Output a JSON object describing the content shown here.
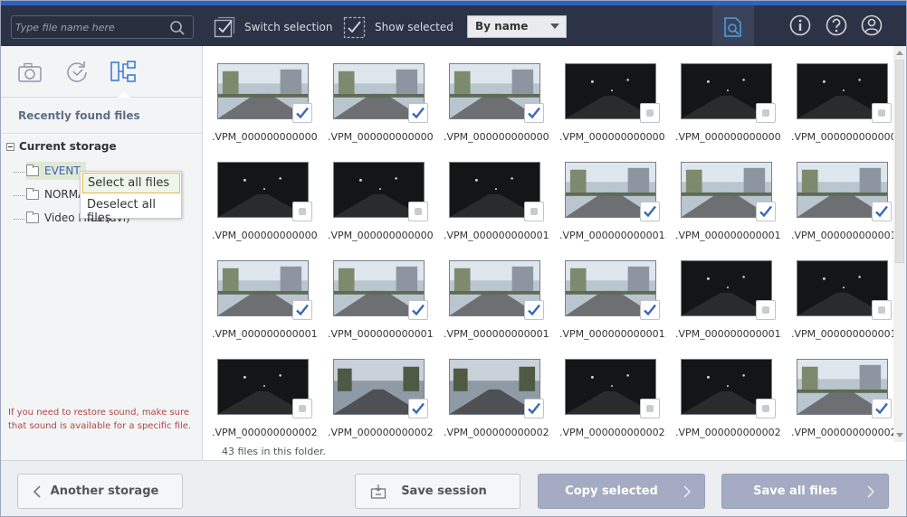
{
  "search": {
    "placeholder": "Type file name here"
  },
  "toolbar": {
    "switch_selection": "Switch selection",
    "show_selected": "Show selected",
    "sort_value": "By name"
  },
  "left": {
    "recent_label": "Recently found files",
    "storage_label": "Current storage",
    "folders": [
      "EVENT",
      "NORMAL",
      "Video Files (avi)"
    ],
    "hint": "If you need to restore sound, make sure that sound is available for a specific file."
  },
  "context_menu": {
    "select_all": "Select all files",
    "deselect_all": "Deselect all files"
  },
  "files": [
    {
      "name": ".VPM_000000000000...",
      "checked": true,
      "scene": "day"
    },
    {
      "name": ".VPM_000000000000...",
      "checked": true,
      "scene": "day"
    },
    {
      "name": ".VPM_000000000000...",
      "checked": true,
      "scene": "day"
    },
    {
      "name": ".VPM_000000000000...",
      "checked": false,
      "scene": "night"
    },
    {
      "name": ".VPM_000000000000...",
      "checked": false,
      "scene": "night"
    },
    {
      "name": ".VPM_000000000000...",
      "checked": false,
      "scene": "night"
    },
    {
      "name": ".VPM_000000000000...",
      "checked": false,
      "scene": "night"
    },
    {
      "name": ".VPM_000000000000...",
      "checked": false,
      "scene": "night"
    },
    {
      "name": ".VPM_000000000001...",
      "checked": false,
      "scene": "night"
    },
    {
      "name": ".VPM_000000000001...",
      "checked": true,
      "scene": "day"
    },
    {
      "name": ".VPM_000000000001...",
      "checked": true,
      "scene": "day"
    },
    {
      "name": ".VPM_000000000001...",
      "checked": true,
      "scene": "day"
    },
    {
      "name": ".VPM_000000000001...",
      "checked": true,
      "scene": "day"
    },
    {
      "name": ".VPM_000000000001...",
      "checked": true,
      "scene": "day"
    },
    {
      "name": ".VPM_000000000001...",
      "checked": true,
      "scene": "day"
    },
    {
      "name": ".VPM_000000000001...",
      "checked": true,
      "scene": "day"
    },
    {
      "name": ".VPM_000000000001...",
      "checked": false,
      "scene": "night"
    },
    {
      "name": ".VPM_000000000001...",
      "checked": false,
      "scene": "night"
    },
    {
      "name": ".VPM_000000000002...",
      "checked": false,
      "scene": "night"
    },
    {
      "name": ".VPM_000000000002...",
      "checked": true,
      "scene": "dusk"
    },
    {
      "name": ".VPM_000000000002...",
      "checked": true,
      "scene": "dusk"
    },
    {
      "name": ".VPM_000000000002...",
      "checked": false,
      "scene": "night"
    },
    {
      "name": ".VPM_000000000002...",
      "checked": false,
      "scene": "night"
    },
    {
      "name": ".VPM_000000000002...",
      "checked": true,
      "scene": "day"
    }
  ],
  "status": "43 files in this folder.",
  "buttons": {
    "another_storage": "Another storage",
    "save_session": "Save session",
    "copy_selected": "Copy selected",
    "save_all": "Save all files"
  },
  "colors": {
    "topbar": "#2d3346",
    "accent": "#2f62c2",
    "check": "#3a67b8",
    "primary_button": "#a4abc3"
  }
}
